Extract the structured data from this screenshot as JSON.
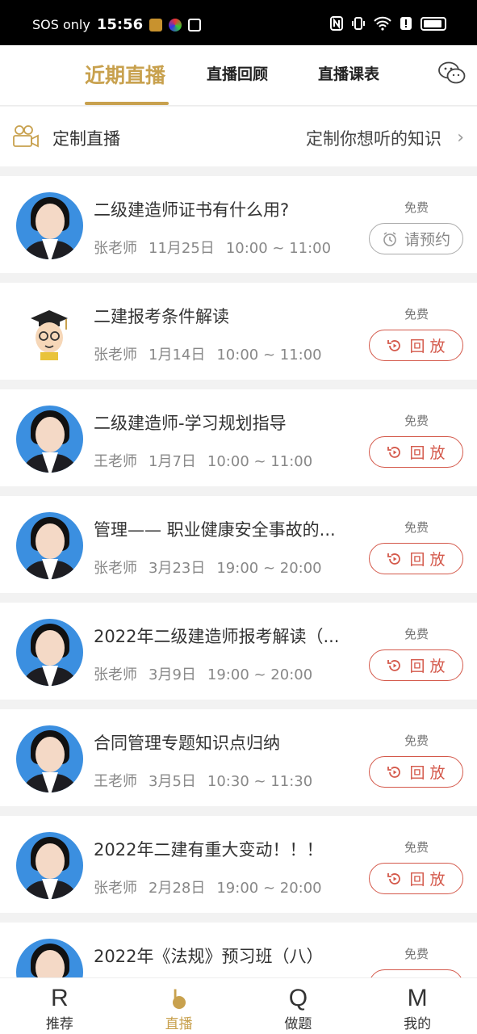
{
  "status_bar": {
    "carrier": "SOS only",
    "time": "15:56"
  },
  "header": {
    "tabs": [
      {
        "label": "近期直播",
        "active": true
      },
      {
        "label": "直播回顾",
        "active": false
      },
      {
        "label": "直播课表",
        "active": false
      }
    ],
    "wechat_icon": "wechat-icon"
  },
  "custom_live": {
    "title": "定制直播",
    "link": "定制你想听的知识"
  },
  "sessions": [
    {
      "title": "二级建造师证书有什么用?",
      "teacher": "张老师",
      "date": "11月25日",
      "time": "10:00 ~ 11:00",
      "price": "免费",
      "action": "请预约",
      "action_type": "reserve",
      "avatar": "female-teacher-photo"
    },
    {
      "title": "二建报考条件解读",
      "teacher": "张老师",
      "date": "1月14日",
      "time": "10:00 ~ 11:00",
      "price": "免费",
      "action": "回 放",
      "action_type": "replay",
      "avatar": "graduate-cartoon"
    },
    {
      "title": "二级建造师-学习规划指导",
      "teacher": "王老师",
      "date": "1月7日",
      "time": "10:00 ~ 11:00",
      "price": "免费",
      "action": "回 放",
      "action_type": "replay",
      "avatar": "female-teacher-photo"
    },
    {
      "title": "管理—— 职业健康安全事故的...",
      "teacher": "张老师",
      "date": "3月23日",
      "time": "19:00 ~ 20:00",
      "price": "免费",
      "action": "回 放",
      "action_type": "replay",
      "avatar": "female-teacher-photo"
    },
    {
      "title": "2022年二级建造师报考解读（...",
      "teacher": "张老师",
      "date": "3月9日",
      "time": "19:00 ~ 20:00",
      "price": "免费",
      "action": "回 放",
      "action_type": "replay",
      "avatar": "female-teacher-photo"
    },
    {
      "title": "合同管理专题知识点归纳",
      "teacher": "王老师",
      "date": "3月5日",
      "time": "10:30 ~ 11:30",
      "price": "免费",
      "action": "回 放",
      "action_type": "replay",
      "avatar": "female-teacher-photo"
    },
    {
      "title": "2022年二建有重大变动！！！",
      "teacher": "张老师",
      "date": "2月28日",
      "time": "19:00 ~ 20:00",
      "price": "免费",
      "action": "回 放",
      "action_type": "replay",
      "avatar": "female-teacher-photo"
    },
    {
      "title": "2022年《法规》预习班（八）",
      "teacher": "",
      "date": "",
      "time": "",
      "price": "免费",
      "action": "",
      "action_type": "replay",
      "avatar": "female-teacher-photo"
    }
  ],
  "bottom_nav": [
    {
      "glyph": "R",
      "label": "推荐",
      "active": false
    },
    {
      "glyph": "L",
      "label": "直播",
      "active": true
    },
    {
      "glyph": "Q",
      "label": "做题",
      "active": false
    },
    {
      "glyph": "M",
      "label": "我的",
      "active": false
    }
  ],
  "colors": {
    "accent": "#c8a14e",
    "replay": "#d4594b"
  }
}
